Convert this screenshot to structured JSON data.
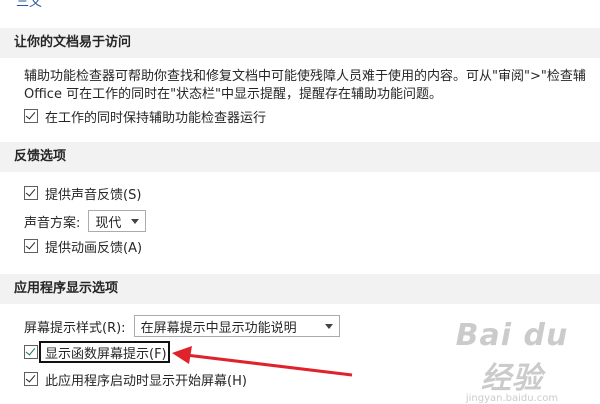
{
  "top_fragment": "三义",
  "accessibility": {
    "header": "让你的文档易于访问",
    "desc_line1": "辅助功能检查器可帮助你查找和修复文档中可能使残障人员难于使用的内容。可从\"审阅\">\"检查辅",
    "desc_line2": "Office 可在工作的同时在\"状态栏\"中显示提醒，提醒存在辅助功能问题。",
    "keep_checker_label": "在工作的同时保持辅助功能检查器运行",
    "keep_checker_checked": true
  },
  "feedback": {
    "header": "反馈选项",
    "sound_feedback_label": "提供声音反馈(S)",
    "sound_feedback_checked": true,
    "sound_scheme_label": "声音方案:",
    "sound_scheme_value": "现代",
    "animation_feedback_label": "提供动画反馈(A)",
    "animation_feedback_checked": true
  },
  "app_display": {
    "header": "应用程序显示选项",
    "screentip_style_label": "屏幕提示样式(R):",
    "screentip_style_value": "在屏幕提示中显示功能说明",
    "show_function_tips_label": "显示函数屏幕提示(F)",
    "show_function_tips_checked": true,
    "show_start_screen_label": "此应用程序启动时显示开始屏幕(H)",
    "show_start_screen_checked": true
  },
  "annotation": {
    "arrow_color": "#e0222b",
    "box_color": "#111111"
  },
  "watermark": {
    "main": "Bai du 经验",
    "sub": "jingyan.baidu.com"
  },
  "colors": {
    "section_header_bg": "#f2f2f2",
    "checkbox_check_green": "#217346"
  }
}
